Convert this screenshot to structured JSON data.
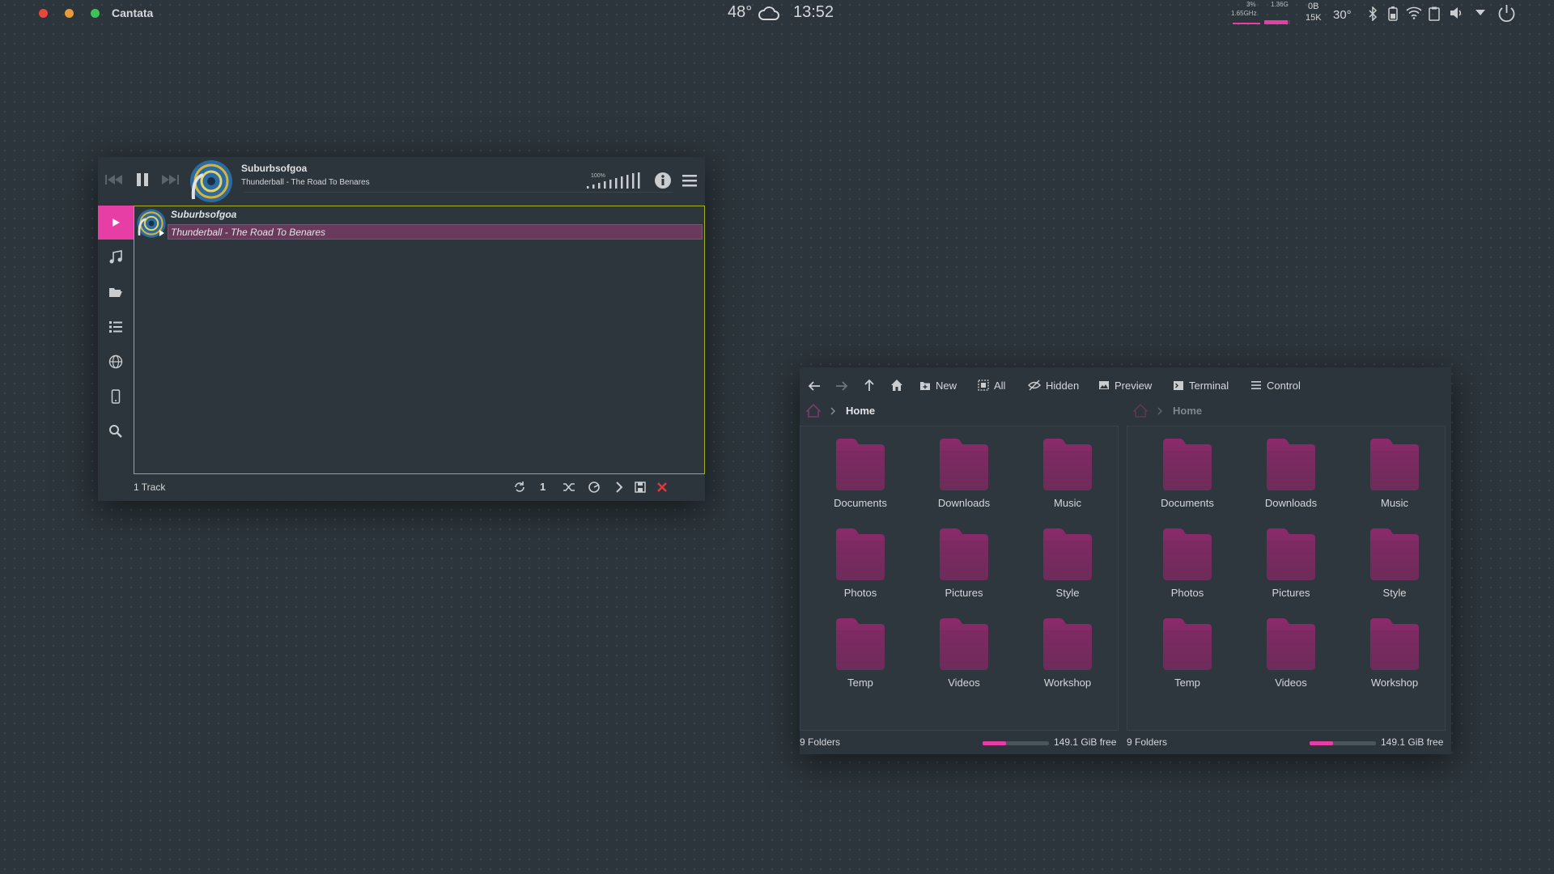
{
  "topbar": {
    "app_name": "Cantata",
    "weather": {
      "temp": "48°",
      "icon": "cloud-icon"
    },
    "clock": "13:52",
    "cpu": {
      "percent": "3%",
      "freq": "1.65GHz"
    },
    "mem": {
      "value": "1.36G",
      "fraction": 0.9
    },
    "net": {
      "down": "0B",
      "up": "15K"
    },
    "cpu_temp": "30°",
    "tray_icons": [
      "bluetooth-icon",
      "battery-icon",
      "wifi-icon",
      "clipboard-icon",
      "volume-icon",
      "chevron-down-icon",
      "power-icon"
    ]
  },
  "cantata": {
    "now_playing": {
      "artist": "Suburbsofgoa",
      "track": "Thunderball - The Road To Benares"
    },
    "volume": "100%",
    "sidebar": [
      "play-queue",
      "music-library",
      "folders",
      "playlists",
      "internet",
      "devices",
      "search"
    ],
    "queue": [
      {
        "artist": "Suburbsofgoa",
        "title": "Thunderball - The Road To Benares"
      }
    ],
    "status": "1 Track",
    "footer_count": "1"
  },
  "dolphin": {
    "toolbar": {
      "new": "New",
      "all": "All",
      "hidden": "Hidden",
      "preview": "Preview",
      "terminal": "Terminal",
      "control": "Control"
    },
    "left": {
      "breadcrumb": "Home",
      "folder_count": "9 Folders",
      "free": "149.1 GiB free",
      "usage": 0.35
    },
    "right": {
      "breadcrumb": "Home",
      "folder_count": "9 Folders",
      "free": "149.1 GiB free",
      "usage": 0.35
    },
    "folders": [
      "Documents",
      "Downloads",
      "Music",
      "Photos",
      "Pictures",
      "Style",
      "Temp",
      "Videos",
      "Workshop"
    ]
  },
  "colors": {
    "accent": "#e73ea6",
    "border_active": "#a8b01f",
    "folder_top": "#8d2a6c",
    "folder_bottom": "#5f2f52"
  }
}
